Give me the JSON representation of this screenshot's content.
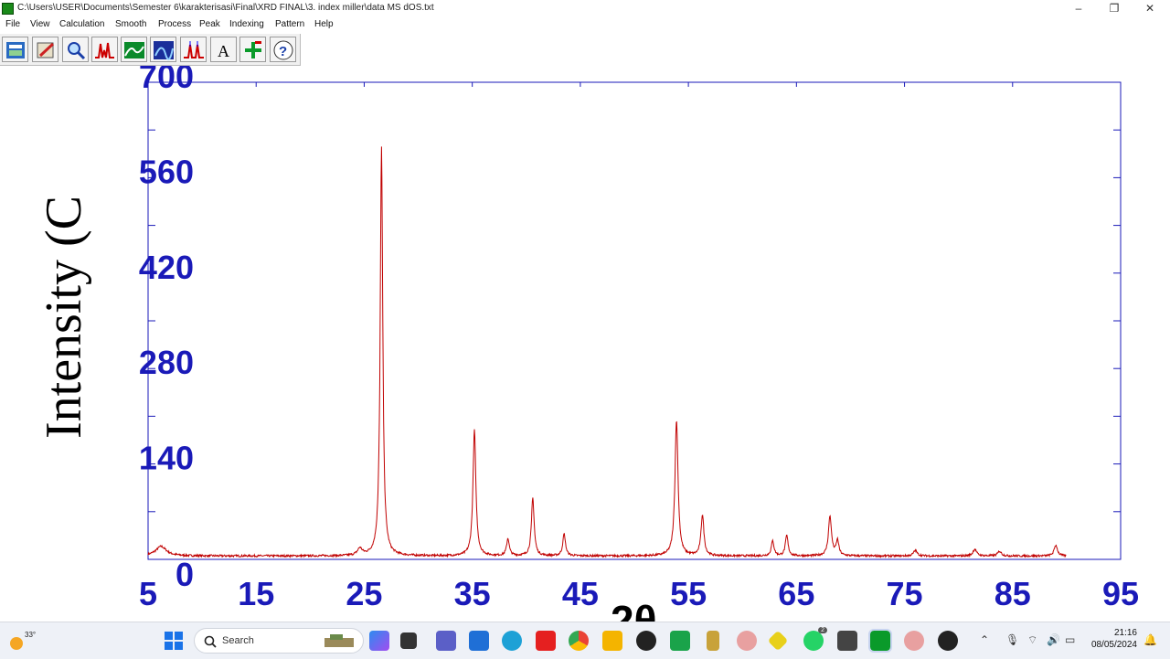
{
  "window": {
    "title": "C:\\Users\\USER\\Documents\\Semester 6\\karakterisasi\\Final\\XRD FINAL\\3. index miller\\data MS dOS.txt",
    "minimize": "–",
    "maximize": "❐",
    "close": "✕"
  },
  "menu": [
    "File",
    "View",
    "Calculation",
    "Smooth",
    "Process",
    "Peak",
    "Indexing",
    "Pattern",
    "Help"
  ],
  "toolbar_icons": [
    "open-file-icon",
    "edit-icon",
    "zoom-icon",
    "peak-icon",
    "smooth-icon",
    "pattern-icon",
    "peak-search-icon",
    "text-icon",
    "crosshair-icon",
    "help-icon"
  ],
  "chart_data": {
    "type": "line",
    "ylabel": "Intensity (C",
    "xlabel": "2θ",
    "x_ticks": [
      "5",
      "15",
      "25",
      "35",
      "45",
      "55",
      "65",
      "75",
      "85",
      "95"
    ],
    "y_ticks": [
      "0",
      "140",
      "280",
      "420",
      "560",
      "700"
    ],
    "xlim": [
      5,
      95
    ],
    "ylim": [
      0,
      700
    ],
    "line_color": "#c00000",
    "tick_label_color": "#1a1ab8",
    "baseline": 5,
    "end_x": 90,
    "peaks": [
      {
        "x": 6.2,
        "y": 14,
        "w": 0.6
      },
      {
        "x": 24.6,
        "y": 10,
        "w": 0.25
      },
      {
        "x": 26.6,
        "y": 600,
        "w": 0.14
      },
      {
        "x": 35.2,
        "y": 185,
        "w": 0.16
      },
      {
        "x": 38.3,
        "y": 25,
        "w": 0.15
      },
      {
        "x": 40.6,
        "y": 85,
        "w": 0.15
      },
      {
        "x": 43.5,
        "y": 32,
        "w": 0.15
      },
      {
        "x": 53.9,
        "y": 200,
        "w": 0.17
      },
      {
        "x": 56.3,
        "y": 60,
        "w": 0.16
      },
      {
        "x": 62.8,
        "y": 22,
        "w": 0.15
      },
      {
        "x": 64.1,
        "y": 30,
        "w": 0.15
      },
      {
        "x": 68.1,
        "y": 58,
        "w": 0.17
      },
      {
        "x": 68.8,
        "y": 22,
        "w": 0.15
      },
      {
        "x": 76.0,
        "y": 8,
        "w": 0.2
      },
      {
        "x": 81.5,
        "y": 10,
        "w": 0.2
      },
      {
        "x": 83.8,
        "y": 7,
        "w": 0.2
      },
      {
        "x": 89.0,
        "y": 16,
        "w": 0.18
      }
    ]
  },
  "taskbar": {
    "weather_temp": "33°",
    "search_label": "Search",
    "clock_time": "21:16",
    "clock_date": "08/05/2024",
    "whatsapp_badge": "2"
  }
}
